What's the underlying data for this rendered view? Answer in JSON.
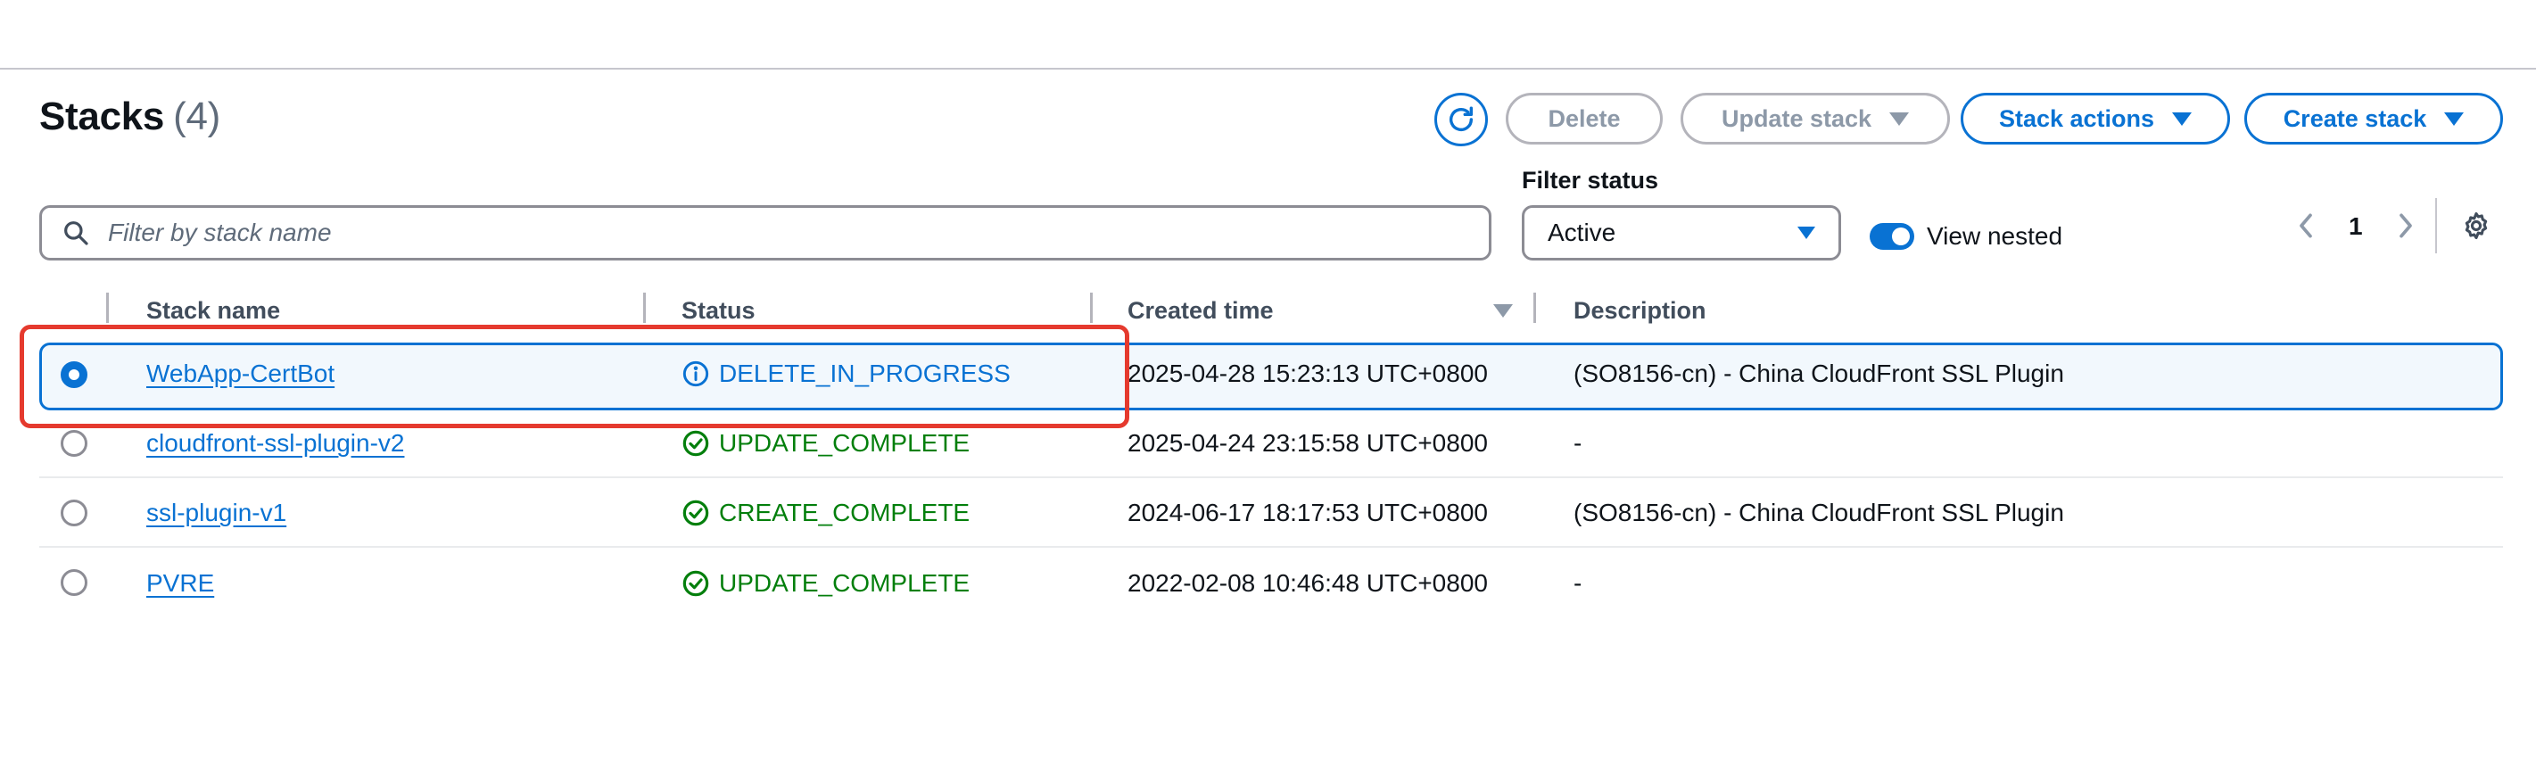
{
  "header": {
    "title": "Stacks",
    "count": "(4)"
  },
  "toolbar": {
    "delete_label": "Delete",
    "update_label": "Update stack",
    "actions_label": "Stack actions",
    "create_label": "Create stack"
  },
  "filter": {
    "search_placeholder": "Filter by stack name",
    "status_label": "Filter status",
    "status_value": "Active",
    "view_nested_label": "View nested",
    "view_nested_on": true
  },
  "pagination": {
    "page": "1"
  },
  "table": {
    "columns": [
      "Stack name",
      "Status",
      "Created time",
      "Description"
    ],
    "rows": [
      {
        "name": "WebApp-CertBot",
        "status": "DELETE_IN_PROGRESS",
        "created": "2025-04-28 15:23:13 UTC+0800",
        "description": "(SO8156-cn) - China CloudFront SSL Plugin",
        "selected": true
      },
      {
        "name": "cloudfront-ssl-plugin-v2",
        "status": "UPDATE_COMPLETE",
        "created": "2025-04-24 23:15:58 UTC+0800",
        "description": "-",
        "selected": false
      },
      {
        "name": "ssl-plugin-v1",
        "status": "CREATE_COMPLETE",
        "created": "2024-06-17 18:17:53 UTC+0800",
        "description": "(SO8156-cn) - China CloudFront SSL Plugin",
        "selected": false
      },
      {
        "name": "PVRE",
        "status": "UPDATE_COMPLETE",
        "created": "2022-02-08 10:46:48 UTC+0800",
        "description": "-",
        "selected": false
      }
    ]
  },
  "colors": {
    "accent": "#0972d3",
    "success": "#037f0c",
    "highlight": "#e53a2e",
    "disabled": "#8d99a8"
  }
}
